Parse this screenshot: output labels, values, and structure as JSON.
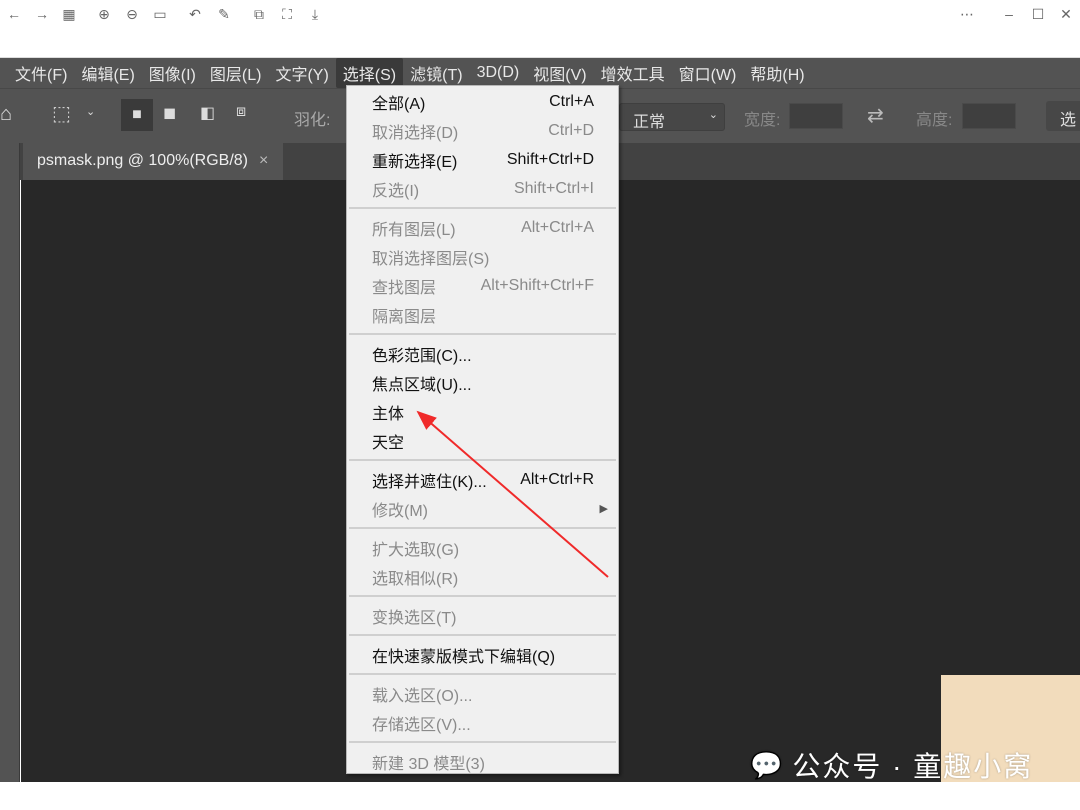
{
  "menubar": [
    "文件(F)",
    "编辑(E)",
    "图像(I)",
    "图层(L)",
    "文字(Y)",
    "选择(S)",
    "滤镜(T)",
    "3D(D)",
    "视图(V)",
    "增效工具",
    "窗口(W)",
    "帮助(H)"
  ],
  "options": {
    "feather_label": "羽化:",
    "style_value": "正常",
    "width_label": "宽度:",
    "height_label": "高度:",
    "select_btn": "选"
  },
  "tab": {
    "title": "psmask.png @ 100%(RGB/8)",
    "close": "×"
  },
  "menu": [
    [
      {
        "label": "全部(A)",
        "shortcut": "Ctrl+A",
        "enabled": true
      },
      {
        "label": "取消选择(D)",
        "shortcut": "Ctrl+D",
        "enabled": false
      },
      {
        "label": "重新选择(E)",
        "shortcut": "Shift+Ctrl+D",
        "enabled": true
      },
      {
        "label": "反选(I)",
        "shortcut": "Shift+Ctrl+I",
        "enabled": false
      }
    ],
    [
      {
        "label": "所有图层(L)",
        "shortcut": "Alt+Ctrl+A",
        "enabled": false
      },
      {
        "label": "取消选择图层(S)",
        "shortcut": "",
        "enabled": false
      },
      {
        "label": "查找图层",
        "shortcut": "Alt+Shift+Ctrl+F",
        "enabled": false
      },
      {
        "label": "隔离图层",
        "shortcut": "",
        "enabled": false
      }
    ],
    [
      {
        "label": "色彩范围(C)...",
        "shortcut": "",
        "enabled": true
      },
      {
        "label": "焦点区域(U)...",
        "shortcut": "",
        "enabled": true
      },
      {
        "label": "主体",
        "shortcut": "",
        "enabled": true
      },
      {
        "label": "天空",
        "shortcut": "",
        "enabled": true
      }
    ],
    [
      {
        "label": "选择并遮住(K)...",
        "shortcut": "Alt+Ctrl+R",
        "enabled": true
      },
      {
        "label": "修改(M)",
        "shortcut": "",
        "enabled": false,
        "submenu": true
      }
    ],
    [
      {
        "label": "扩大选取(G)",
        "shortcut": "",
        "enabled": false
      },
      {
        "label": "选取相似(R)",
        "shortcut": "",
        "enabled": false
      }
    ],
    [
      {
        "label": "变换选区(T)",
        "shortcut": "",
        "enabled": false
      }
    ],
    [
      {
        "label": "在快速蒙版模式下编辑(Q)",
        "shortcut": "",
        "enabled": true
      }
    ],
    [
      {
        "label": "载入选区(O)...",
        "shortcut": "",
        "enabled": false
      },
      {
        "label": "存储选区(V)...",
        "shortcut": "",
        "enabled": false
      }
    ],
    [
      {
        "label": "新建 3D 模型(3)",
        "shortcut": "",
        "enabled": false
      }
    ]
  ],
  "watermark": "公众号 · 童趣小窝",
  "colors": {
    "annotation_arrow": "#f02a2a"
  }
}
